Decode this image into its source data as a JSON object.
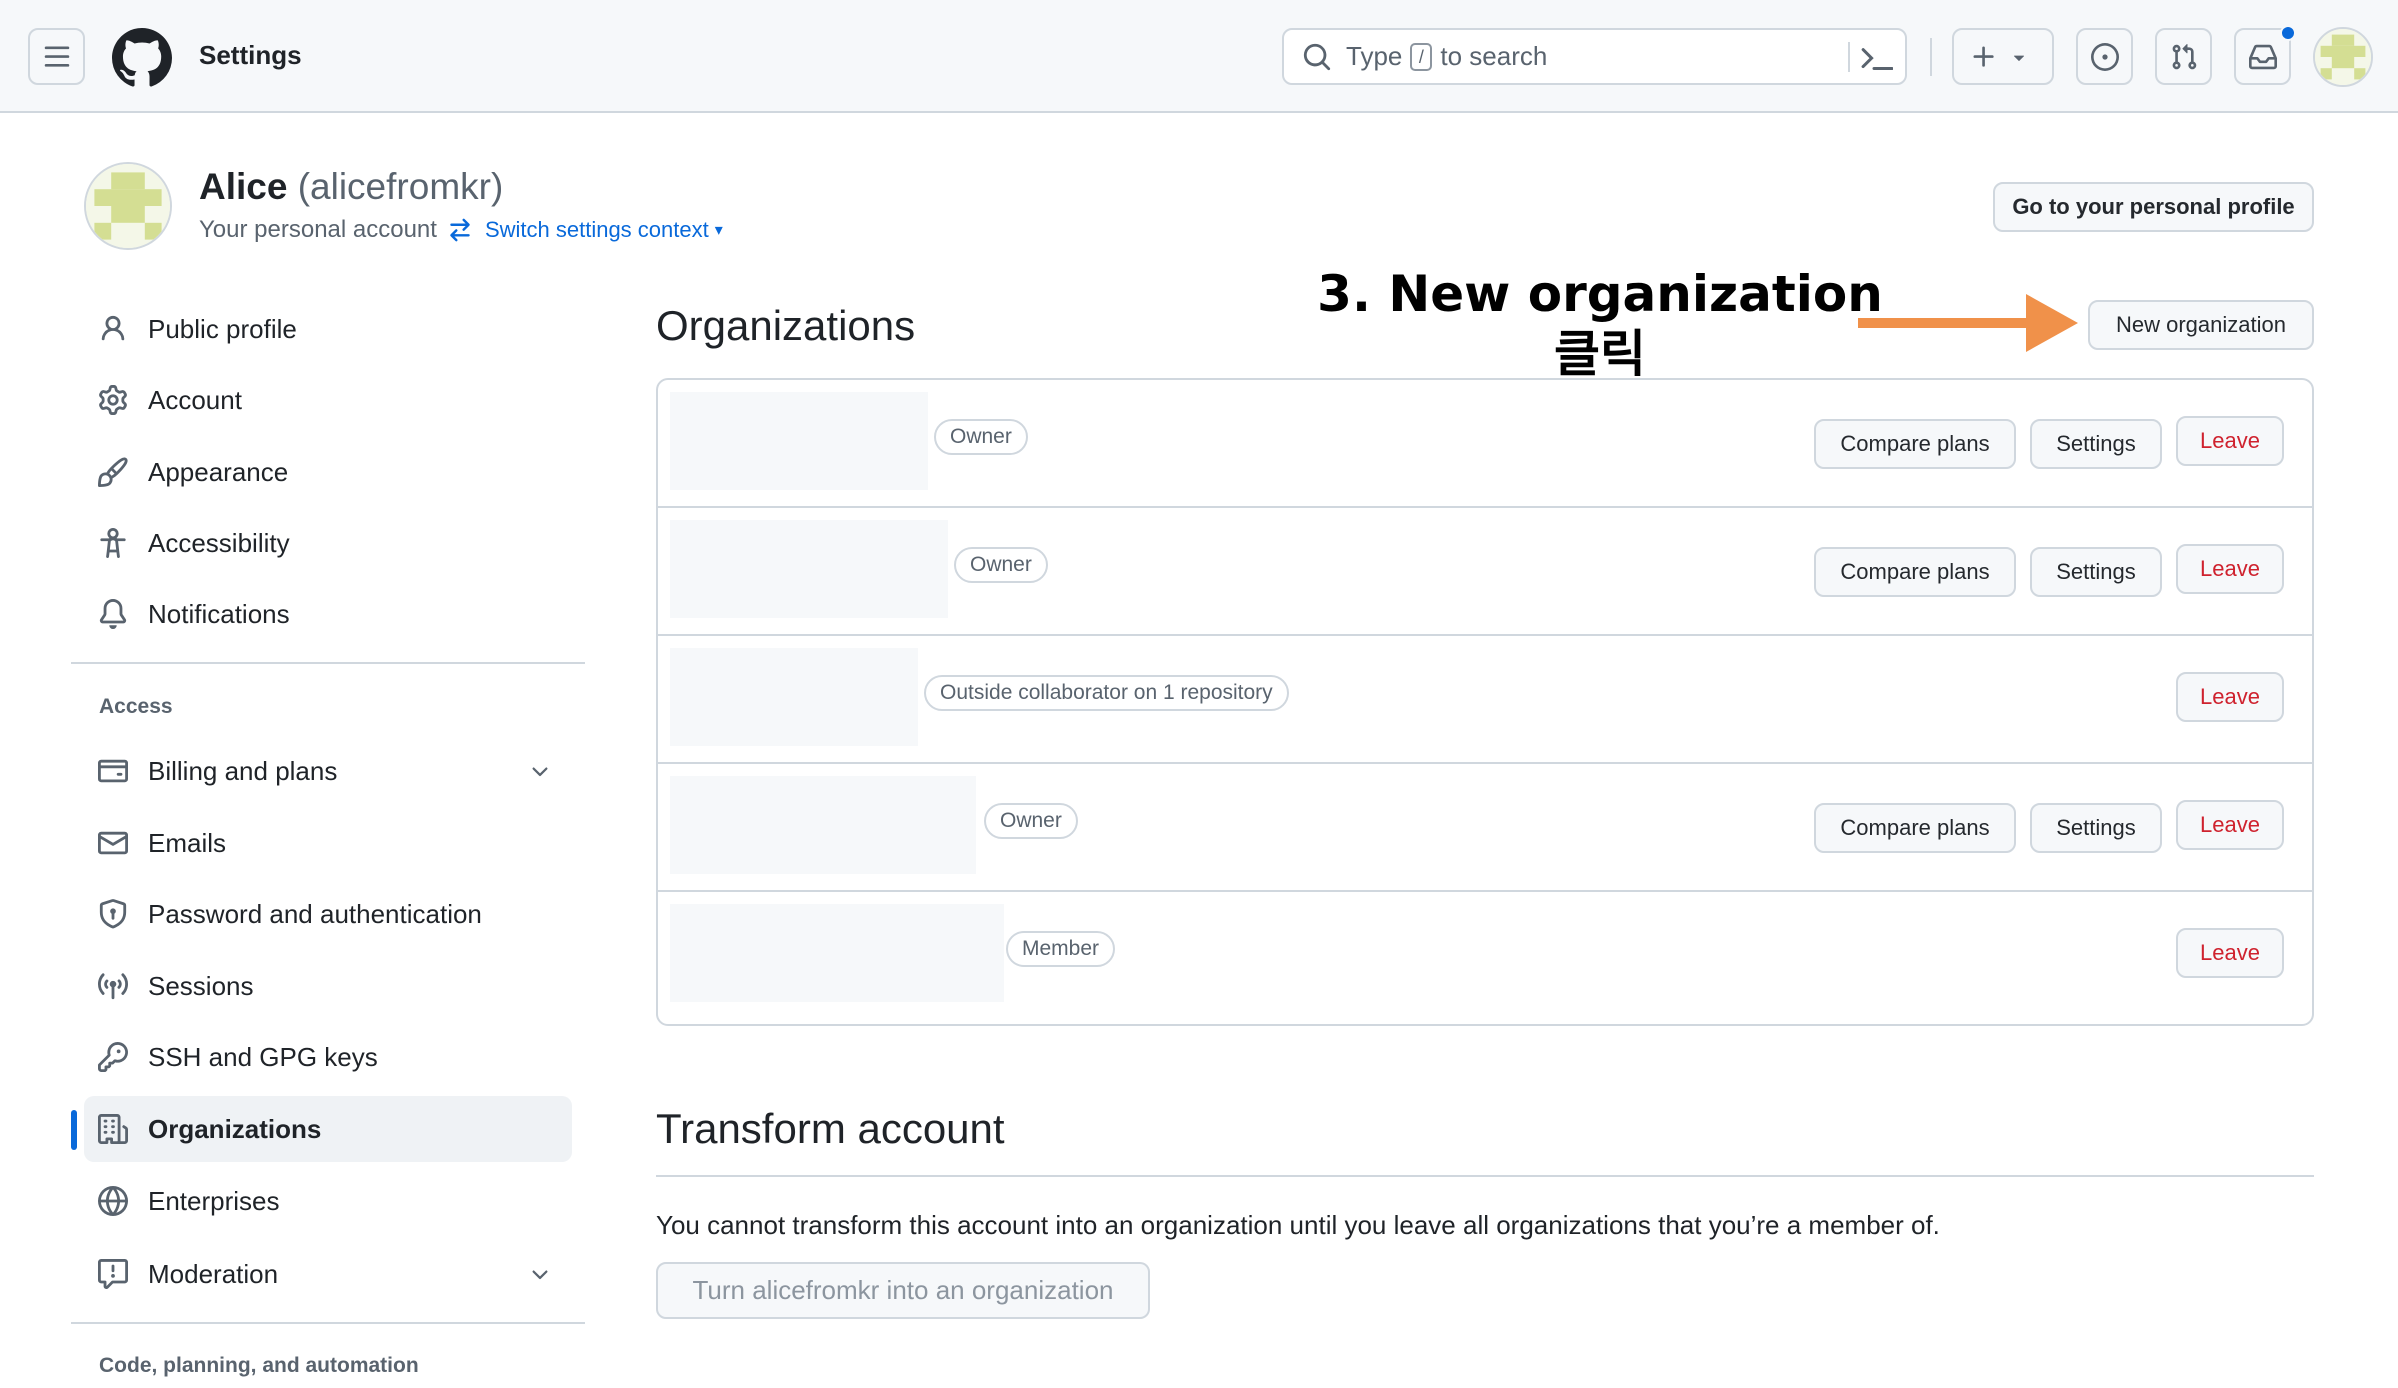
{
  "header": {
    "context_title": "Settings",
    "search": {
      "prefix": "Type",
      "key": "/",
      "suffix": "to search"
    },
    "icons": [
      "hamburger-icon",
      "github-logo-icon",
      "search-icon",
      "command-palette-icon",
      "plus-icon",
      "triangle-down-icon",
      "issue-opened-icon",
      "pull-request-icon",
      "inbox-icon"
    ]
  },
  "user": {
    "display_name": "Alice",
    "login": "(alicefromkr)",
    "subtitle": "Your personal account",
    "switch_label": "Switch settings context",
    "profile_button": "Go to your personal profile"
  },
  "sidebar": {
    "top_items": [
      {
        "label": "Public profile",
        "icon": "person-icon"
      },
      {
        "label": "Account",
        "icon": "gear-icon"
      },
      {
        "label": "Appearance",
        "icon": "paintbrush-icon"
      },
      {
        "label": "Accessibility",
        "icon": "accessibility-icon"
      },
      {
        "label": "Notifications",
        "icon": "bell-icon"
      }
    ],
    "access_heading": "Access",
    "access_items": [
      {
        "label": "Billing and plans",
        "icon": "credit-card-icon",
        "expandable": true
      },
      {
        "label": "Emails",
        "icon": "mail-icon"
      },
      {
        "label": "Password and authentication",
        "icon": "shield-lock-icon"
      },
      {
        "label": "Sessions",
        "icon": "broadcast-icon"
      },
      {
        "label": "SSH and GPG keys",
        "icon": "key-icon"
      },
      {
        "label": "Organizations",
        "icon": "organization-icon",
        "active": true
      },
      {
        "label": "Enterprises",
        "icon": "globe-icon"
      },
      {
        "label": "Moderation",
        "icon": "report-icon",
        "expandable": true
      }
    ],
    "code_heading": "Code, planning, and automation"
  },
  "organizations": {
    "heading": "Organizations",
    "new_button": "New organization",
    "rows": [
      {
        "role": "Owner",
        "buttons": [
          "Compare plans",
          "Settings"
        ],
        "leave": "Leave"
      },
      {
        "role": "Owner",
        "buttons": [
          "Compare plans",
          "Settings"
        ],
        "leave": "Leave"
      },
      {
        "role": "Outside collaborator on 1 repository",
        "buttons": [],
        "leave": "Leave"
      },
      {
        "role": "Owner",
        "buttons": [
          "Compare plans",
          "Settings"
        ],
        "leave": "Leave"
      },
      {
        "role": "Member",
        "buttons": [],
        "leave": "Leave"
      }
    ]
  },
  "annotation": {
    "line1": "3. New organization",
    "line2": "클릭",
    "arrow_color": "#f0914a"
  },
  "transform": {
    "heading": "Transform account",
    "description": "You cannot transform this account into an organization until you leave all organizations that you’re a member of.",
    "button": "Turn alicefromkr into an organization"
  },
  "colors": {
    "accent": "#0969da",
    "danger": "#cf222e",
    "border": "#d0d7de"
  }
}
